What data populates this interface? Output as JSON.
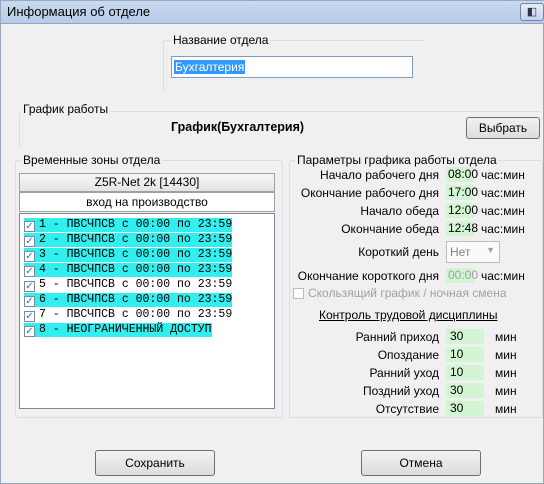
{
  "window": {
    "title": "Информация об отделе",
    "title_button": "◧"
  },
  "department": {
    "label": "Название отдела",
    "value": "Бухгалтерия"
  },
  "schedule": {
    "label": "График работы",
    "value": "График(Бухгалтерия)",
    "choose_label": "Выбрать"
  },
  "zones": {
    "label": "Временные зоны отдела",
    "controller": "Z5R-Net 2k [14430]",
    "entrance": "вход на производство",
    "items": [
      {
        "text": "1 - ПВСЧПСВ с 00:00 по 23:59",
        "checked": true,
        "highlight": true
      },
      {
        "text": "2 - ПВСЧПСВ с 00:00 по 23:59",
        "checked": true,
        "highlight": true
      },
      {
        "text": "3 - ПВСЧПСВ с 00:00 по 23:59",
        "checked": true,
        "highlight": true
      },
      {
        "text": "4 - ПВСЧПСВ с 00:00 по 23:59",
        "checked": true,
        "highlight": true
      },
      {
        "text": "5 - ПВСЧПСВ с 00:00 по 23:59",
        "checked": true,
        "highlight": false
      },
      {
        "text": "6 - ПВСЧПСВ с 00:00 по 23:59",
        "checked": true,
        "highlight": true
      },
      {
        "text": "7 - ПВСЧПСВ с 00:00 по 23:59",
        "checked": true,
        "highlight": false
      },
      {
        "text": "8 - НЕОГРАНИЧЕННЫЙ ДОСТУП",
        "checked": true,
        "highlight": true
      }
    ]
  },
  "params": {
    "label": "Параметры графика работы отдела",
    "workday_start": {
      "label": "Начало рабочего дня",
      "value": "08:00",
      "unit": "час:мин"
    },
    "workday_end": {
      "label": "Окончание рабочего дня",
      "value": "17:00",
      "unit": "час:мин"
    },
    "lunch_start": {
      "label": "Начало обеда",
      "value": "12:00",
      "unit": "час:мин"
    },
    "lunch_end": {
      "label": "Окончание обеда",
      "value": "12:48",
      "unit": "час:мин"
    },
    "short_day": {
      "label": "Короткий день",
      "value": "Нет"
    },
    "short_day_end": {
      "label": "Окончание короткого дня",
      "value": "00:00",
      "unit": "час:мин"
    },
    "sliding": {
      "label": "Скользящий график / ночная смена"
    },
    "discipline_title": "Контроль трудовой дисциплины",
    "early_arrival": {
      "label": "Ранний приход",
      "value": "30",
      "unit": "мин"
    },
    "late": {
      "label": "Опоздание",
      "value": "10",
      "unit": "мин"
    },
    "early_leave": {
      "label": "Ранний уход",
      "value": "10",
      "unit": "мин"
    },
    "late_leave": {
      "label": "Поздний уход",
      "value": "30",
      "unit": "мин"
    },
    "absence": {
      "label": "Отсутствие",
      "value": "30",
      "unit": "мин"
    }
  },
  "footer": {
    "save_label": "Сохранить",
    "cancel_label": "Отмена"
  }
}
